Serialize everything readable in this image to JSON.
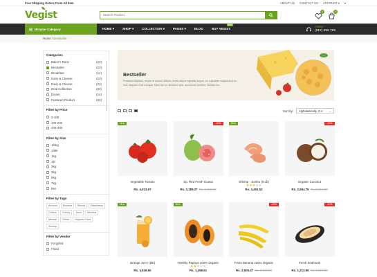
{
  "topbar": {
    "promo": "Free Shipping Orders From All Item",
    "links": [
      "ABOUT US",
      "CONTACT US",
      "ACCOUNT ▾",
      "▾"
    ]
  },
  "header": {
    "logo": "Vegist",
    "search_placeholder": "Search Product",
    "wishlist_count": "0",
    "cart_count": "0"
  },
  "nav": {
    "browse": "Browse Category",
    "menu": [
      "HOME ▾",
      "SHOP ▾",
      "COLLECTION ▾",
      "PAGES ▾",
      "BLOG",
      "BUY VEGIST"
    ],
    "new_badge": "NEW",
    "hotline_label": "Hotline",
    "hotline_number": "(012) 456 789"
  },
  "breadcrumb": {
    "home": "Home",
    "sep": "/",
    "current": "Bestseller"
  },
  "sidebar": {
    "categories_title": "Categories",
    "categories": [
      {
        "label": "Baker's Rack",
        "count": "(22)",
        "checked": false
      },
      {
        "label": "Bestseller",
        "count": "(22)",
        "checked": true
      },
      {
        "label": "Breakfast",
        "count": "(14)",
        "checked": false
      },
      {
        "label": "Dairy & Cheese",
        "count": "(22)",
        "checked": false
      },
      {
        "label": "Dairy & Cheese",
        "count": "(22)",
        "checked": false
      },
      {
        "label": "Deal Collection",
        "count": "(22)",
        "checked": false
      },
      {
        "label": "Dinner",
        "count": "(14)",
        "checked": false
      },
      {
        "label": "Featured Product",
        "count": "(22)",
        "checked": false
      }
    ],
    "price_title": "Filter by Price",
    "prices": [
      "0-100",
      "100-200",
      "200-300"
    ],
    "size_title": "Filter by Size",
    "sizes": [
      "1/4kg",
      "1/8kr",
      "1kg",
      "1ltr",
      "2kg",
      "3kg",
      "5kg",
      "7kg",
      "RM"
    ],
    "tags_title": "Filter by Tags",
    "tags": [
      "Almond",
      "Banana",
      "Biscuit",
      "Blackberry",
      "Chikoo",
      "Cherry",
      "Juice",
      "Minimal",
      "Mussel",
      "Onion",
      "Organic Food",
      "Shrimp"
    ],
    "vendor_title": "Filter by Vendor",
    "vendors": [
      "Forgyfed",
      "Fitout"
    ]
  },
  "banner": {
    "title": "Bestseller",
    "text": "Praesent dapibus, neque id cursus ultrices, tortor neque egestas augue, eu vulputate magna eros eu erat. Aliquam erat volutpat. Nam dui mi, tincidunt quis, accumsan porttitor, facilisis luc..."
  },
  "toolbar": {
    "sort_label": "Sort by:",
    "sort_value": "Alphabetically, Z-A"
  },
  "products": [
    {
      "name": "Vegetable Tomato",
      "price": "Rs. 4,013.67",
      "old": "",
      "badge": "New",
      "badge_type": "new",
      "rating": 0,
      "img": "tomato"
    },
    {
      "name": "Sp. Red Fresh Guava",
      "price": "Rs. 2,189.27",
      "old": "Rs. 3,210.00",
      "badge": "-32%",
      "badge_type": "off",
      "rating": 0,
      "img": "guava"
    },
    {
      "name": "Shrimp - Jumbo (6 Lb)",
      "price": "Rs. 4,461.52",
      "old": "",
      "badge": "New",
      "badge_type": "new",
      "rating": 3,
      "img": "shrimp"
    },
    {
      "name": "Organic Coconut",
      "price": "Rs. 2,554.76",
      "old": "Rs. 3,210.00",
      "badge": "-20%",
      "badge_type": "off",
      "rating": 0,
      "img": "coconut"
    },
    {
      "name": "Orange Juice (5ltr)",
      "price": "Rs. 4,816.60",
      "old": "",
      "badge": "New",
      "badge_type": "new",
      "rating": 0,
      "img": "juice"
    },
    {
      "name": "Healthy Papaya 100% Organic",
      "price": "Rs. 1,458.51",
      "old": "",
      "badge": "New",
      "badge_type": "new",
      "rating": 2,
      "img": "papaya"
    },
    {
      "name": "Fruits Banana 100% Organic",
      "price": "Rs. 2,505.47",
      "old": "Rs. 3,210.00",
      "badge": "-20%",
      "badge_type": "off",
      "rating": 0,
      "img": "banana"
    },
    {
      "name": "Fresh Seafoods",
      "price": "Rs. 1,213.95",
      "old": "Rs. 3,210.00",
      "badge": "-10%",
      "badge_type": "off",
      "rating": 0,
      "img": "mussel"
    }
  ],
  "colors": {
    "accent": "#6aa31f",
    "sale": "#e5312b",
    "nav": "#2b2b2b"
  }
}
